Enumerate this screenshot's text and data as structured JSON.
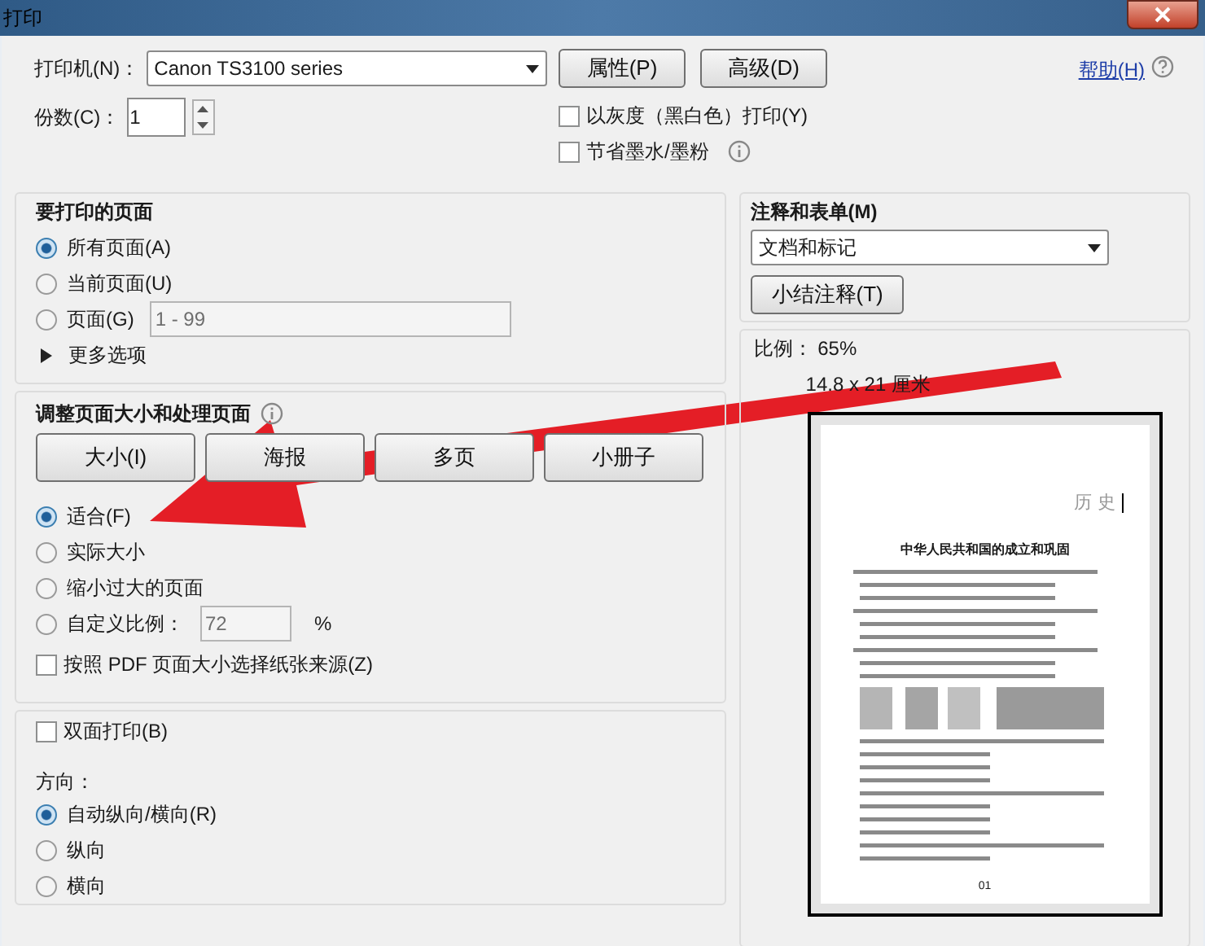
{
  "window": {
    "title": "打印"
  },
  "printer": {
    "label": "打印机(N)：",
    "value": "Canon TS3100 series",
    "buttons": [
      "属性(P)",
      "高级(D)"
    ]
  },
  "help": {
    "label": "帮助(H)"
  },
  "copies": {
    "label": "份数(C)：",
    "value": "1"
  },
  "options": [
    {
      "label": "以灰度（黑白色）打印(Y)",
      "checked": false,
      "info": false
    },
    {
      "label": "节省墨水/墨粉",
      "checked": false,
      "info": true
    }
  ],
  "pages": {
    "title": "要打印的页面",
    "choices": [
      {
        "label": "所有页面(A)",
        "selected": true
      },
      {
        "label": "当前页面(U)",
        "selected": false
      },
      {
        "label": "页面(G)",
        "selected": false,
        "value": "1 - 99",
        "disabled": true
      }
    ],
    "more": "更多选项"
  },
  "sizing": {
    "title": "调整页面大小和处理页面",
    "modes": [
      "大小(I)",
      "海报",
      "多页",
      "小册子"
    ],
    "choices": [
      {
        "label": "适合(F)",
        "selected": true
      },
      {
        "label": "实际大小",
        "selected": false
      },
      {
        "label": "缩小过大的页面",
        "selected": false
      },
      {
        "label": "自定义比例：",
        "selected": false,
        "value": "72",
        "unit": "%",
        "disabled": true
      }
    ],
    "paper_source": {
      "label": "按照 PDF 页面大小选择纸张来源(Z)",
      "checked": false
    }
  },
  "duplex": {
    "label": "双面打印(B)",
    "checked": false
  },
  "orientation": {
    "title": "方向：",
    "choices": [
      {
        "label": "自动纵向/横向(R)",
        "selected": true
      },
      {
        "label": "纵向",
        "selected": false
      },
      {
        "label": "横向",
        "selected": false
      }
    ]
  },
  "annotations": {
    "title": "注释和表单(M)",
    "value": "文档和标记",
    "button": "小结注释(T)"
  },
  "preview": {
    "scale": "比例： 65%",
    "size": "14.8 x 21 厘米",
    "header": "历 史",
    "doc_title": "中华人民共和国的成立和巩固",
    "page_number": "01"
  }
}
